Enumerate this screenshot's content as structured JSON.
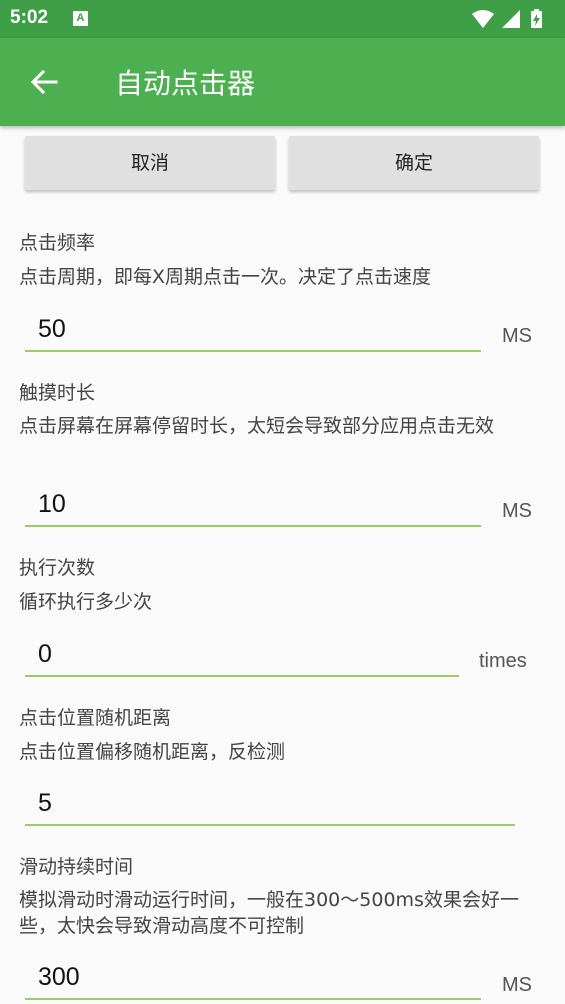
{
  "status_bar": {
    "time": "5:02",
    "notification_icon": "A",
    "icons": [
      "wifi-icon",
      "signal-icon",
      "battery-charging-icon"
    ]
  },
  "app_bar": {
    "back_icon": "arrow-left-icon",
    "title": "自动点击器"
  },
  "actions": {
    "cancel_label": "取消",
    "confirm_label": "确定"
  },
  "settings": [
    {
      "label": "点击频率",
      "description": "点击周期，即每X周期点击一次。决定了点击速度",
      "value": "50",
      "unit": "MS"
    },
    {
      "label": "触摸时长",
      "description": "点击屏幕在屏幕停留时长，太短会导致部分应用点击无效",
      "value": "10",
      "unit": "MS"
    },
    {
      "label": "执行次数",
      "description": "循环执行多少次",
      "value": "0",
      "unit": "times"
    },
    {
      "label": "点击位置随机距离",
      "description": "点击位置偏移随机距离，反检测",
      "value": "5",
      "unit": ""
    },
    {
      "label": "滑动持续时间",
      "description": "模拟滑动时滑动运行时间，一般在300～500ms效果会好一些，太快会导致滑动高度不可控制",
      "value": "300",
      "unit": "MS"
    }
  ],
  "colors": {
    "status_bar": "#3e9f46",
    "app_bar": "#4caf50",
    "field_underline": "#9ccc65",
    "background": "#fafafa"
  }
}
